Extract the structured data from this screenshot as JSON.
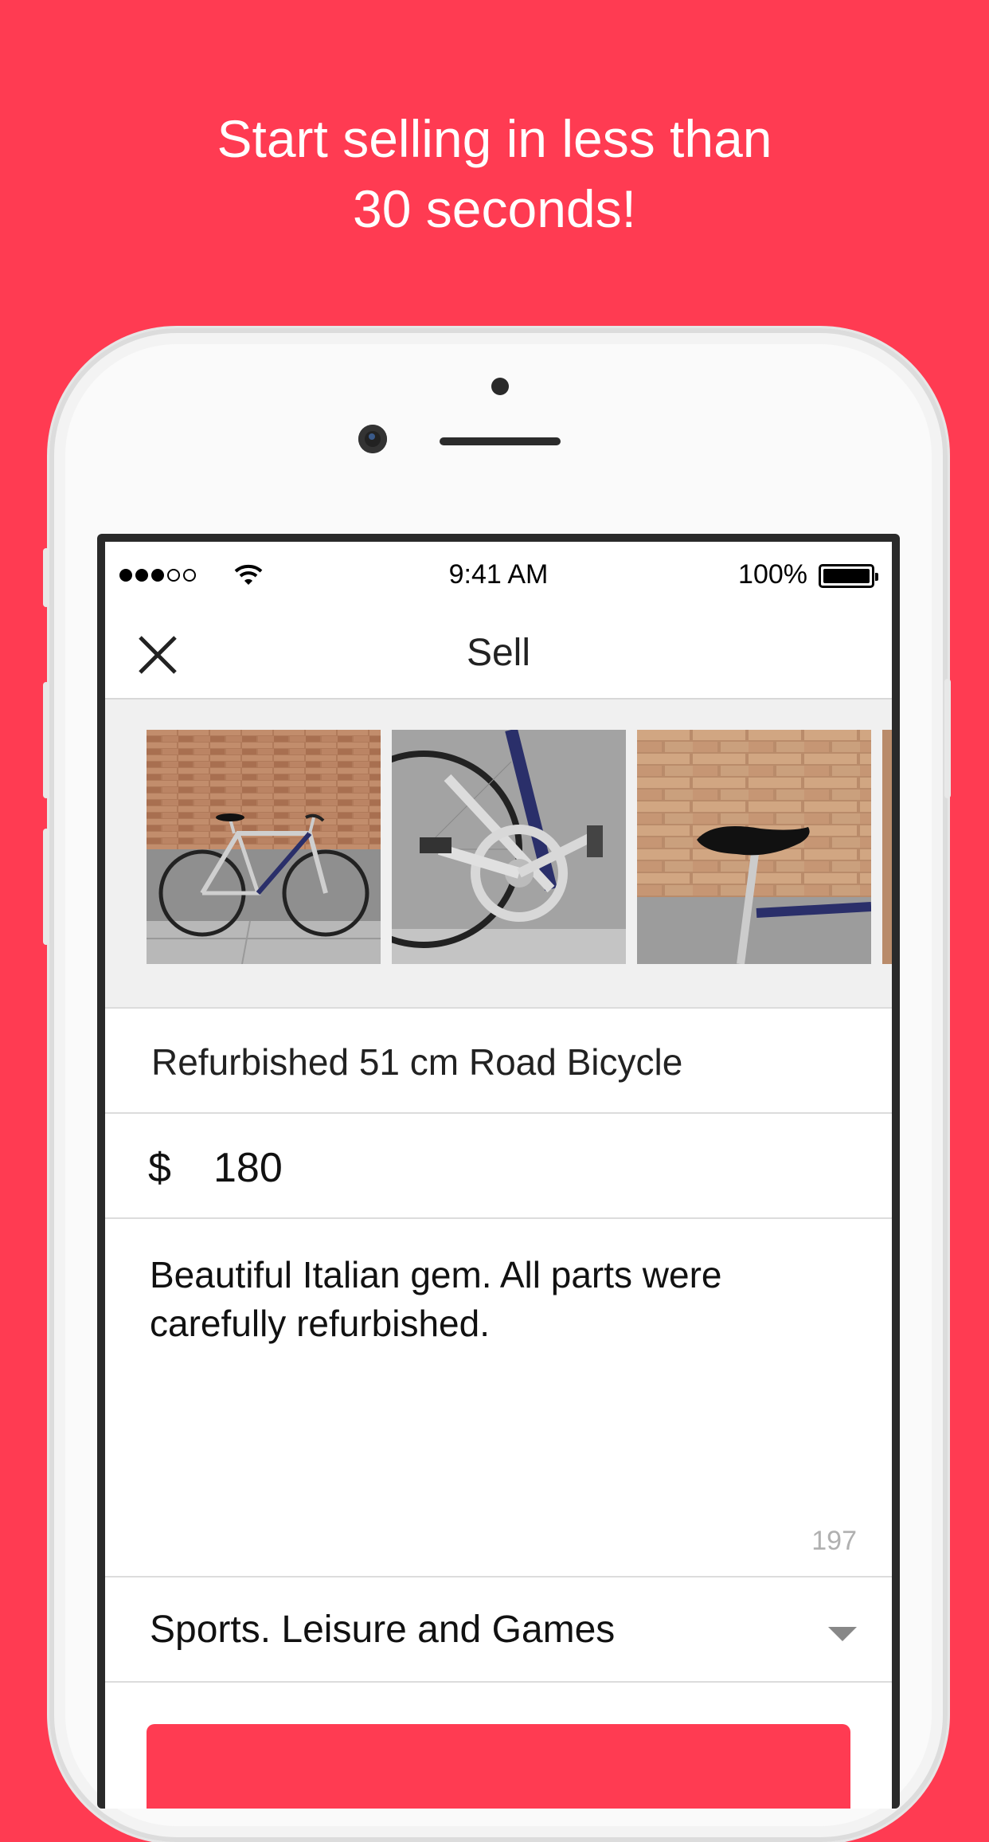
{
  "promo": {
    "line1": "Start selling in less than",
    "line2": "30 seconds!"
  },
  "status_bar": {
    "time": "9:41 AM",
    "battery": "100%"
  },
  "nav": {
    "title": "Sell"
  },
  "photos": [
    {
      "alt": "Road bicycle full view"
    },
    {
      "alt": "Bicycle crankset close-up"
    },
    {
      "alt": "Bicycle saddle close-up"
    }
  ],
  "form": {
    "title_value": "Refurbished 51 cm Road Bicycle",
    "currency": "$",
    "price_value": "180",
    "description_value": "Beautiful Italian gem. All parts were carefully refurbished.",
    "char_count": "197",
    "category_value": "Sports. Leisure and Games"
  },
  "colors": {
    "brand": "#FF3B52"
  }
}
